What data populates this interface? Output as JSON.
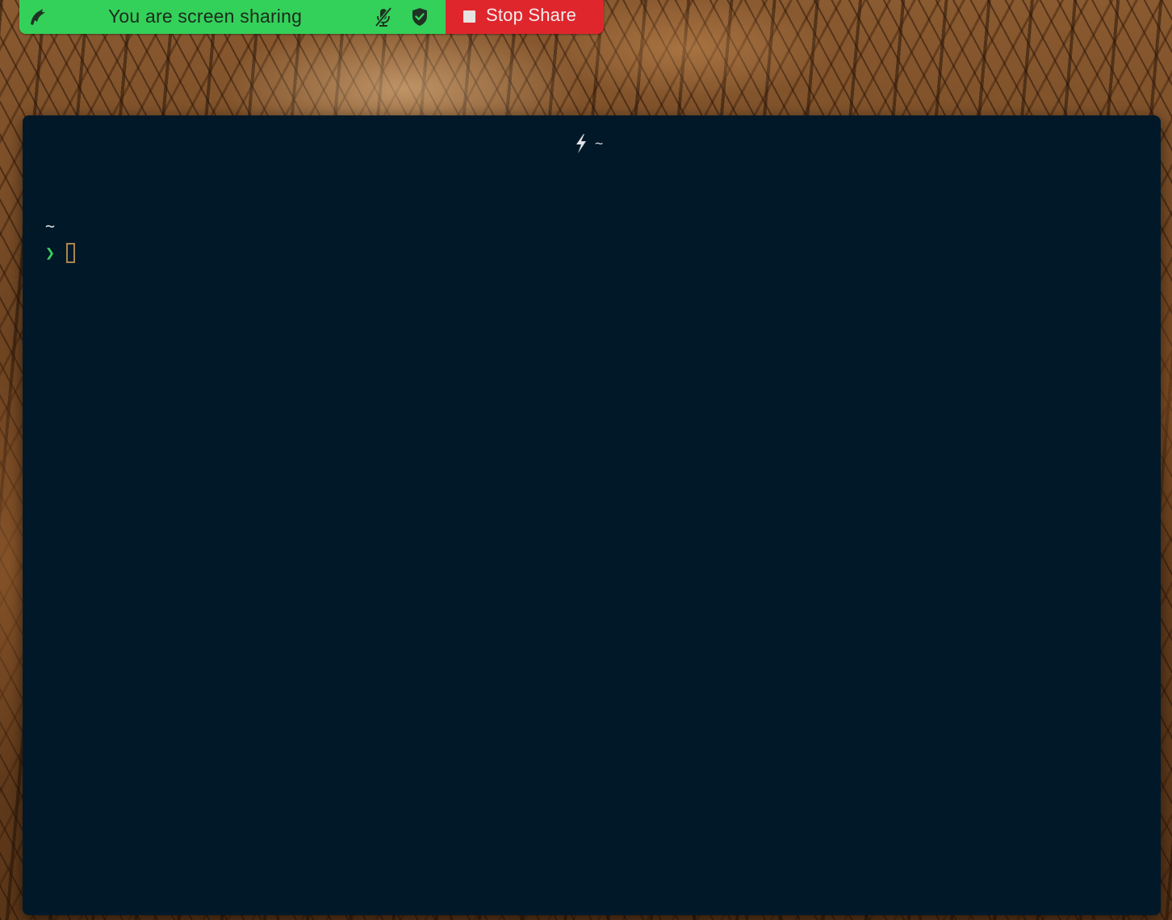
{
  "share_bar": {
    "status_text": "You are screen sharing",
    "stop_label": "Stop Share",
    "status_color": "#34d15a",
    "stop_color": "#e0262d",
    "icons": [
      "app-logo-icon",
      "mic-muted-icon",
      "shield-check-icon",
      "stop-square-icon"
    ]
  },
  "terminal": {
    "title_icon": "lightning-bolt-icon",
    "title": "~",
    "cwd": "~",
    "prompt_symbol": "❯",
    "prompt_color": "#3bd15e",
    "background_color": "#001828",
    "cursor_color": "#a88650"
  }
}
